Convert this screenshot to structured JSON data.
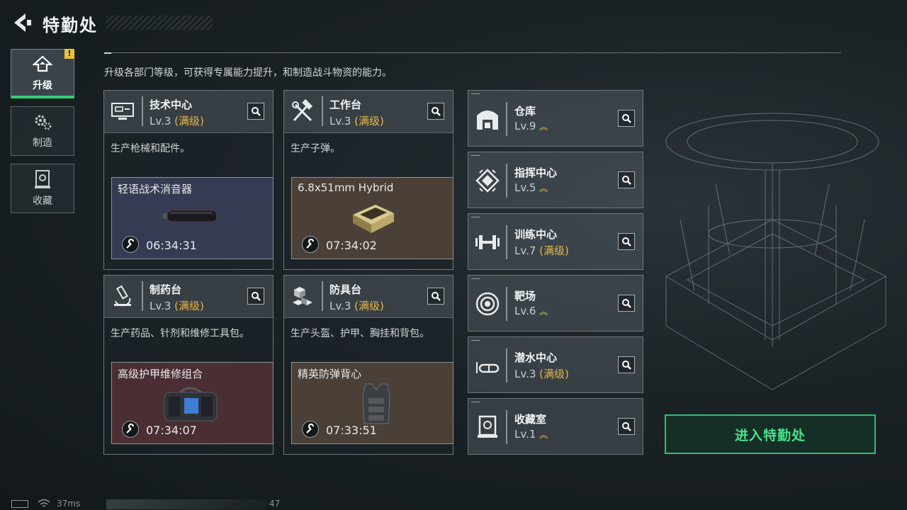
{
  "header": {
    "title": "特勤处",
    "back_icon": "back-arrow-icon"
  },
  "sidebar": {
    "items": [
      {
        "label": "升级",
        "icon": "upgrade-icon",
        "active": true,
        "alert": "!"
      },
      {
        "label": "制造",
        "icon": "gears-icon",
        "active": false
      },
      {
        "label": "收藏",
        "icon": "collection-icon",
        "active": false
      }
    ]
  },
  "description": "升级各部门等级，可获得专属能力提升，和制造战斗物资的能力。",
  "cards": [
    {
      "name": "技术中心",
      "level": "Lv.3",
      "status": "(满级)",
      "desc": "生产枪械和配件。",
      "item": "轻语战术消音器",
      "time": "06:34:31",
      "slot_color": "#363a52",
      "icon": "computer-icon"
    },
    {
      "name": "工作台",
      "level": "Lv.3",
      "status": "(满级)",
      "desc": "生产子弹。",
      "item": "6.8x51mm Hybrid",
      "time": "07:34:02",
      "slot_color": "#4a4037",
      "icon": "hammer-wrench-icon"
    },
    {
      "name": "制药台",
      "level": "Lv.3",
      "status": "(满级)",
      "desc": "生产药品、针剂和维修工具包。",
      "item": "高级护甲维修组合",
      "time": "07:34:07",
      "slot_color": "#4a2e33",
      "icon": "microscope-icon"
    },
    {
      "name": "防具台",
      "level": "Lv.3",
      "status": "(满级)",
      "desc": "生产头盔、护甲、胸挂和背包。",
      "item": "精英防弹背心",
      "time": "07:33:51",
      "slot_color": "#4a4037",
      "icon": "blocks-icon"
    }
  ],
  "facilities": [
    {
      "name": "仓库",
      "level": "Lv.9",
      "status": "",
      "upgradable": true,
      "icon": "warehouse-icon"
    },
    {
      "name": "指挥中心",
      "level": "Lv.5",
      "status": "",
      "upgradable": true,
      "icon": "chip-icon"
    },
    {
      "name": "训练中心",
      "level": "Lv.7",
      "status": "(满级)",
      "upgradable": false,
      "icon": "dumbbell-icon"
    },
    {
      "name": "靶场",
      "level": "Lv.6",
      "status": "",
      "upgradable": true,
      "icon": "target-icon"
    },
    {
      "name": "潜水中心",
      "level": "Lv.3",
      "status": "(满级)",
      "upgradable": false,
      "icon": "diving-mask-icon"
    },
    {
      "name": "收藏室",
      "level": "Lv.1",
      "status": "",
      "upgradable": true,
      "icon": "trophy-case-icon"
    }
  ],
  "enter_button": "进入特勤处",
  "status_bar": {
    "ping": "37ms",
    "fps": "47"
  },
  "colors": {
    "accent_green": "#2fbf74",
    "maxed_gold": "#e6b84a",
    "alert_yellow": "#e9c23a"
  }
}
